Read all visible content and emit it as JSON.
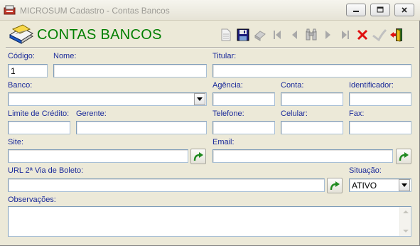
{
  "window": {
    "title": "MICROSUM Cadastro - Contas Bancos",
    "controls": {
      "minimize": "minimize-icon",
      "maximize": "maximize-icon",
      "close": "close-icon"
    }
  },
  "header": {
    "title": "CONTAS BANCOS",
    "icon": "book-icon",
    "title_color": "#007f00"
  },
  "toolbar": {
    "buttons": [
      {
        "name": "new-record",
        "icon": "document-icon",
        "enabled": false
      },
      {
        "name": "save",
        "icon": "floppy-disk-icon",
        "enabled": true
      },
      {
        "name": "edit",
        "icon": "edit-icon",
        "enabled": false
      },
      {
        "name": "first",
        "icon": "first-record-icon",
        "enabled": false
      },
      {
        "name": "previous",
        "icon": "previous-record-icon",
        "enabled": false
      },
      {
        "name": "search",
        "icon": "binoculars-icon",
        "enabled": false
      },
      {
        "name": "next",
        "icon": "next-record-icon",
        "enabled": false
      },
      {
        "name": "last",
        "icon": "last-record-icon",
        "enabled": false
      },
      {
        "name": "cancel",
        "icon": "red-x-icon",
        "enabled": true
      },
      {
        "name": "confirm",
        "icon": "checkmark-icon",
        "enabled": false
      },
      {
        "name": "exit",
        "icon": "exit-door-icon",
        "enabled": true
      }
    ]
  },
  "form": {
    "codigo": {
      "label": "Código:",
      "value": "1"
    },
    "nome": {
      "label": "Nome:",
      "value": ""
    },
    "titular": {
      "label": "Titular:",
      "value": ""
    },
    "banco": {
      "label": "Banco:",
      "value": ""
    },
    "agencia": {
      "label": "Agência:",
      "value": ""
    },
    "conta": {
      "label": "Conta:",
      "value": ""
    },
    "identificador": {
      "label": "Identificador:",
      "value": ""
    },
    "limite": {
      "label": "Limite de Crédito:",
      "value": ""
    },
    "gerente": {
      "label": "Gerente:",
      "value": ""
    },
    "telefone": {
      "label": "Telefone:",
      "value": ""
    },
    "celular": {
      "label": "Celular:",
      "value": ""
    },
    "fax": {
      "label": "Fax:",
      "value": ""
    },
    "site": {
      "label": "Site:",
      "value": ""
    },
    "email": {
      "label": "Email:",
      "value": ""
    },
    "url_boleto": {
      "label": "URL 2ª Via de Boleto:",
      "value": ""
    },
    "situacao": {
      "label": "Situação:",
      "value": "ATIVO"
    },
    "observacoes": {
      "label": "Observações:",
      "value": ""
    }
  },
  "colors": {
    "label": "#1a2a9a",
    "go_arrow": "#1f8a1f",
    "cancel_red": "#e01010"
  }
}
